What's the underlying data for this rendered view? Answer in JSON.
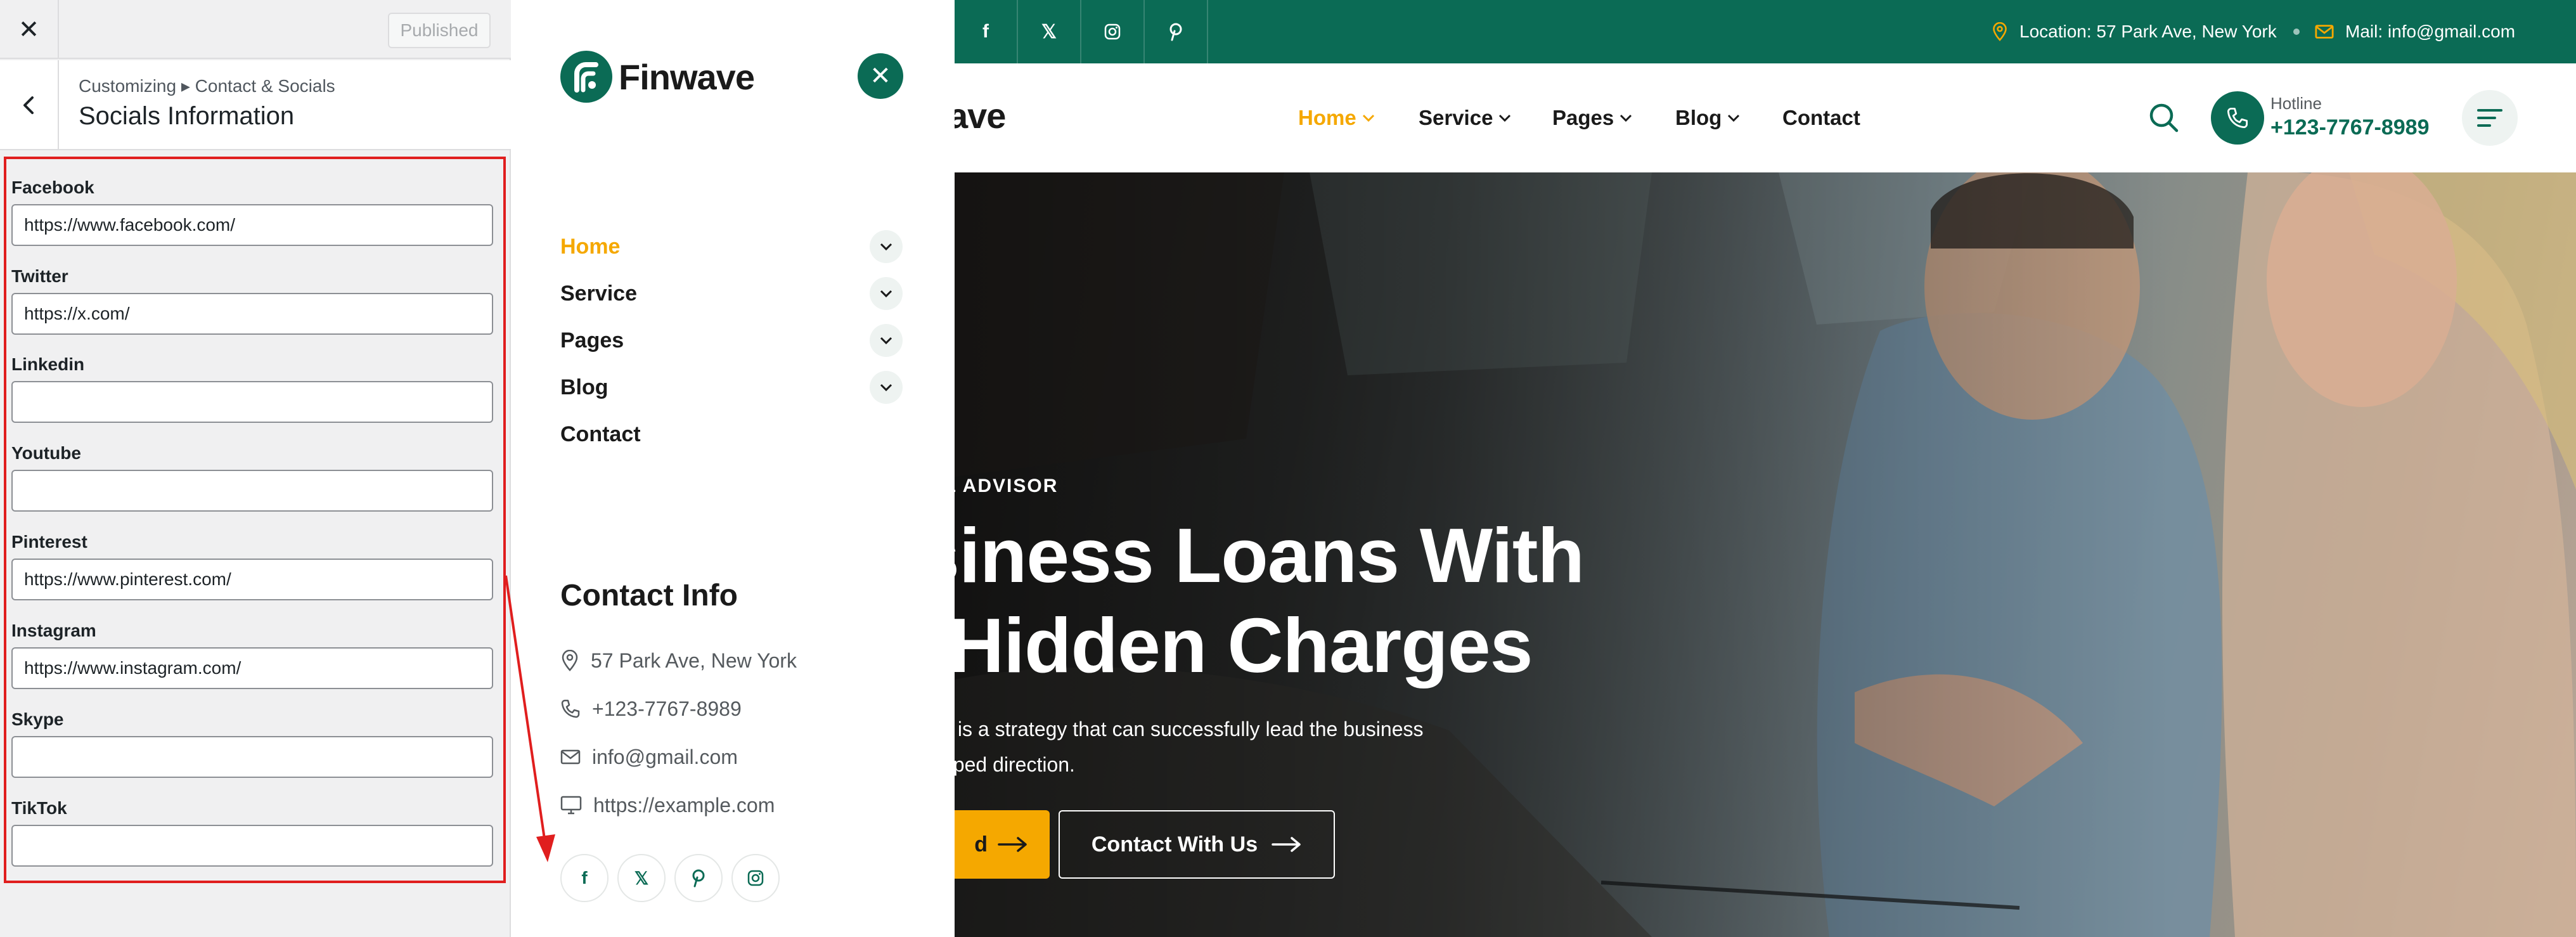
{
  "customizer": {
    "close_icon": "close-icon",
    "publish_label": "Published",
    "breadcrumb": "Customizing ▸ Contact & Socials",
    "section_title": "Socials Information",
    "fields": [
      {
        "label": "Facebook",
        "value": "https://www.facebook.com/"
      },
      {
        "label": "Twitter",
        "value": "https://x.com/"
      },
      {
        "label": "Linkedin",
        "value": ""
      },
      {
        "label": "Youtube",
        "value": ""
      },
      {
        "label": "Pinterest",
        "value": "https://www.pinterest.com/"
      },
      {
        "label": "Instagram",
        "value": "https://www.instagram.com/"
      },
      {
        "label": "Skype",
        "value": ""
      },
      {
        "label": "TikTok",
        "value": ""
      }
    ],
    "highlight_color": "#e01e1e"
  },
  "offcanvas": {
    "logo_name": "Finwave",
    "nav": [
      {
        "label": "Home",
        "active": true
      },
      {
        "label": "Service"
      },
      {
        "label": "Pages"
      },
      {
        "label": "Blog"
      },
      {
        "label": "Contact"
      }
    ],
    "contact_title": "Contact Info",
    "contact": {
      "address": "57 Park Ave, New York",
      "phone": "+123-7767-8989",
      "email": "info@gmail.com",
      "website": "https://example.com"
    },
    "socials": [
      "facebook-icon",
      "x-icon",
      "pinterest-icon",
      "instagram-icon"
    ]
  },
  "site": {
    "topbar": {
      "socials": [
        "facebook-icon",
        "x-icon",
        "instagram-icon",
        "pinterest-icon"
      ],
      "location": "Location: 57 Park Ave, New York",
      "mail": "Mail: info@gmail.com"
    },
    "header": {
      "brand_partial": "ave",
      "nav": [
        {
          "label": "Home",
          "active": true
        },
        {
          "label": "Service"
        },
        {
          "label": "Pages"
        },
        {
          "label": "Blog"
        },
        {
          "label": "Contact"
        }
      ],
      "hotline_label": "Hotline",
      "hotline_number": "+123-7767-8989"
    },
    "hero": {
      "subtitle": "AL ADVISOR",
      "title_line1": "siness Loans With",
      "title_line2": "Hidden Charges",
      "desc_line1": "y is a strategy that can successfully lead the business",
      "desc_line2": "oped direction.",
      "primary_button": "d",
      "secondary_button": "Contact With Us"
    },
    "colors": {
      "primary": "#0b6b55",
      "accent": "#f5a800"
    }
  }
}
